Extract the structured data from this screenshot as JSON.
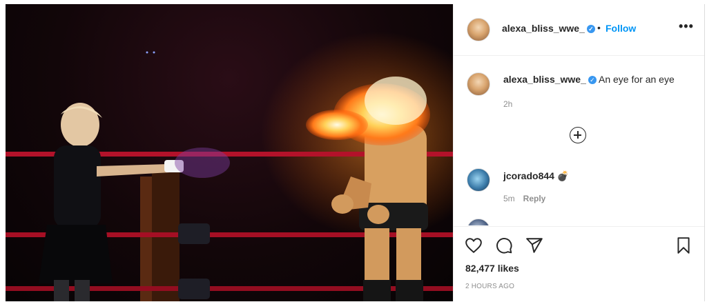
{
  "post": {
    "username": "alexa_bliss_wwe_",
    "verified": true,
    "separator": "•",
    "follow_label": "Follow",
    "more_label": "•••"
  },
  "caption": {
    "username": "alexa_bliss_wwe_",
    "text": "An eye for an eye",
    "time": "2h"
  },
  "comments": [
    {
      "username": "jcorado844",
      "text": "💣",
      "time": "5m",
      "reply_label": "Reply"
    }
  ],
  "likes": "82,477 likes",
  "posted_ago": "2 HOURS AGO",
  "icons": [
    "heart-icon",
    "comment-icon",
    "share-icon",
    "bookmark-icon",
    "add-comment-circle-icon",
    "verified-badge-icon",
    "more-options-icon"
  ],
  "colors": {
    "follow": "#0095f6",
    "verified": "#3897f0",
    "secondary_text": "#8e8e8e",
    "ring_rope": "#b3122a"
  }
}
